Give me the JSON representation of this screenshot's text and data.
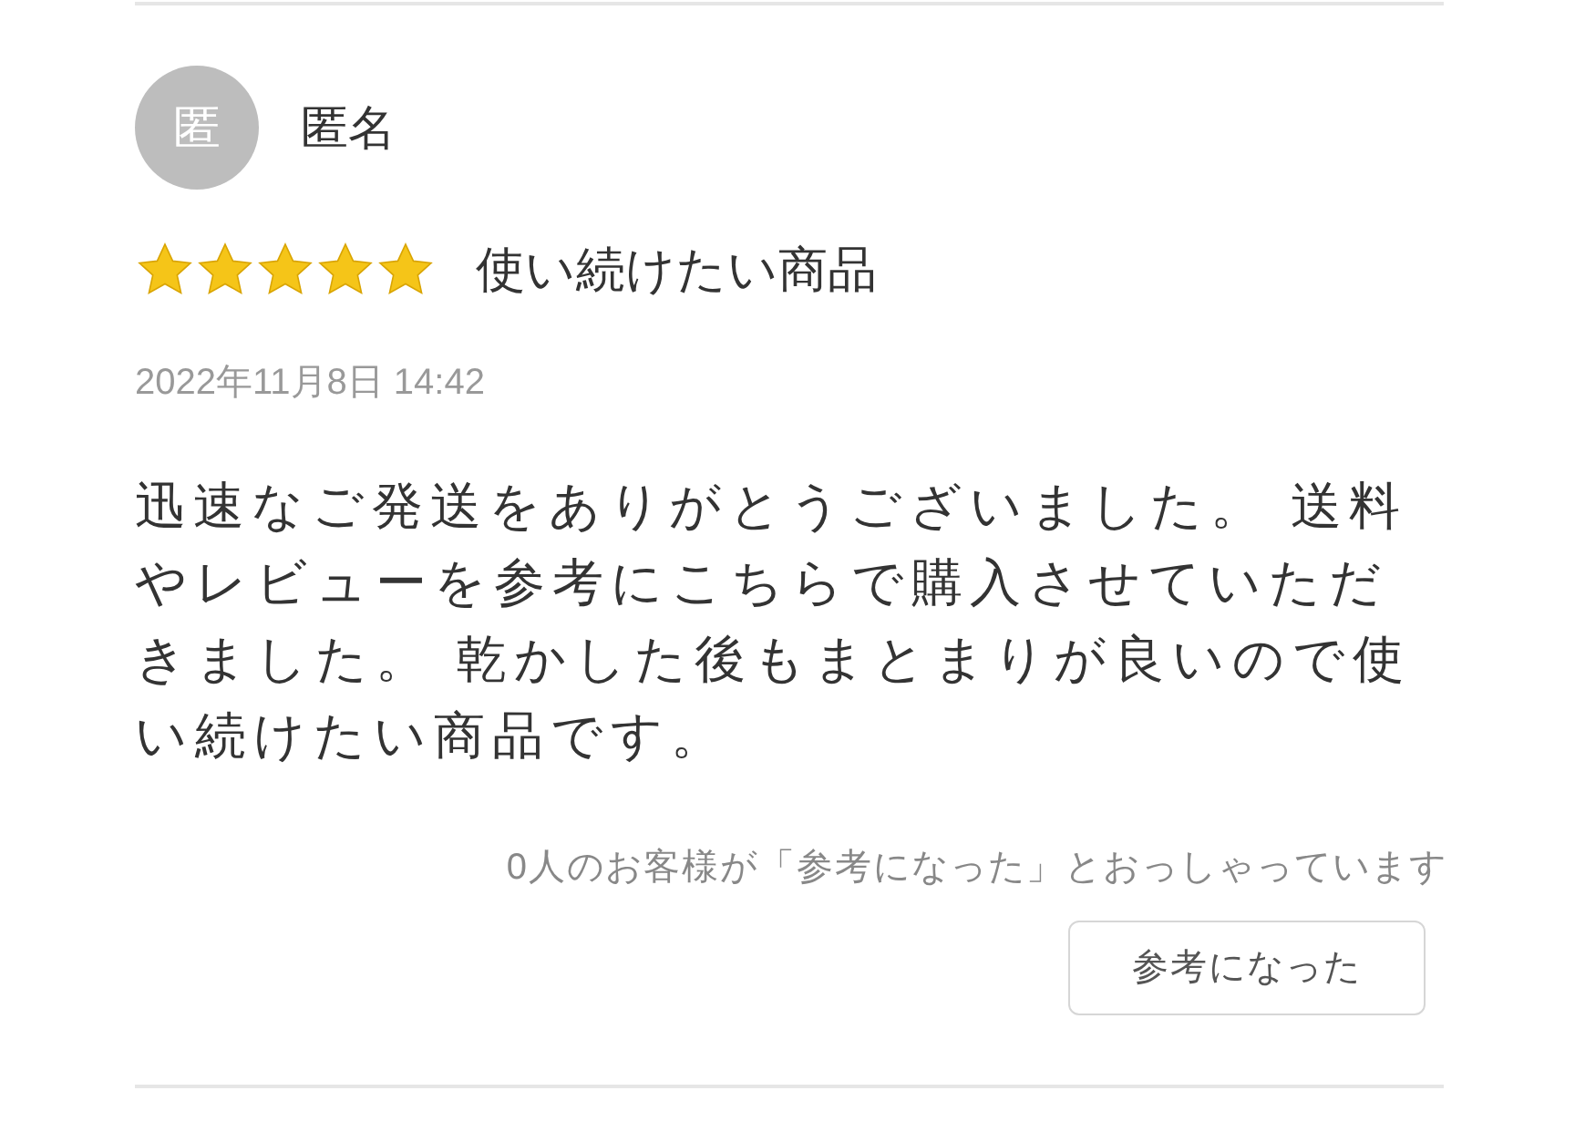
{
  "review": {
    "avatar": "匿",
    "author": "匿名",
    "stars": 5,
    "title": "使い続けたい商品",
    "date": "2022年11月8日 14:42",
    "body": "迅速なご発送をありがとうございました。 送料やレビューを参考にこちらで購入させていただきました。 乾かした後もまとまりが良いので使い続けたい商品です。",
    "helpful_count": "0人のお客様が「参考になった」とおっしゃっています",
    "helpful_button": "参考になった"
  }
}
